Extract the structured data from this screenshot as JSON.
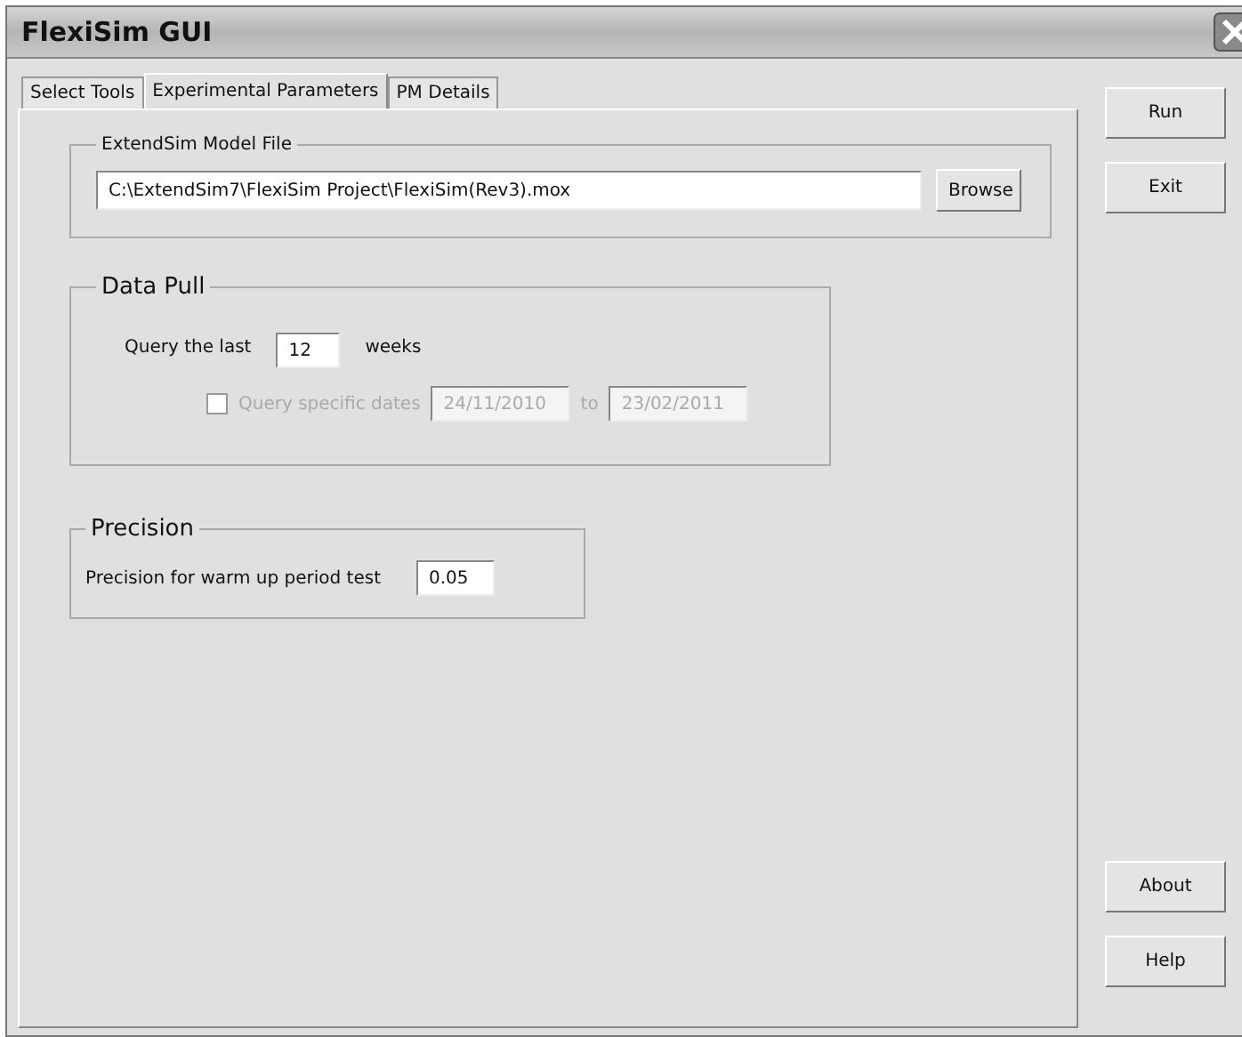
{
  "window": {
    "title": "FlexiSim GUI"
  },
  "tabs": [
    {
      "label": "Select Tools",
      "selected": false
    },
    {
      "label": "Experimental Parameters",
      "selected": true
    },
    {
      "label": "PM Details",
      "selected": false
    }
  ],
  "model_file": {
    "title": "ExtendSim Model File",
    "value": "C:\\ExtendSim7\\FlexiSim Project\\FlexiSim(Rev3).mox",
    "browse": "Browse"
  },
  "data_pull": {
    "title": "Data Pull",
    "query_label": "Query the last",
    "weeks_value": "12",
    "weeks_label": "weeks",
    "specific_label": "Query specific dates",
    "specific_checked": false,
    "disabled": true,
    "from": "24/11/2010",
    "to_label": "to",
    "to": "23/02/2011"
  },
  "precision": {
    "title": "Precision",
    "label": "Precision for warm up period test",
    "value": "0.05"
  },
  "top_buttons": [
    "Run",
    "Exit"
  ],
  "bottom_buttons": [
    "About",
    "Help"
  ]
}
